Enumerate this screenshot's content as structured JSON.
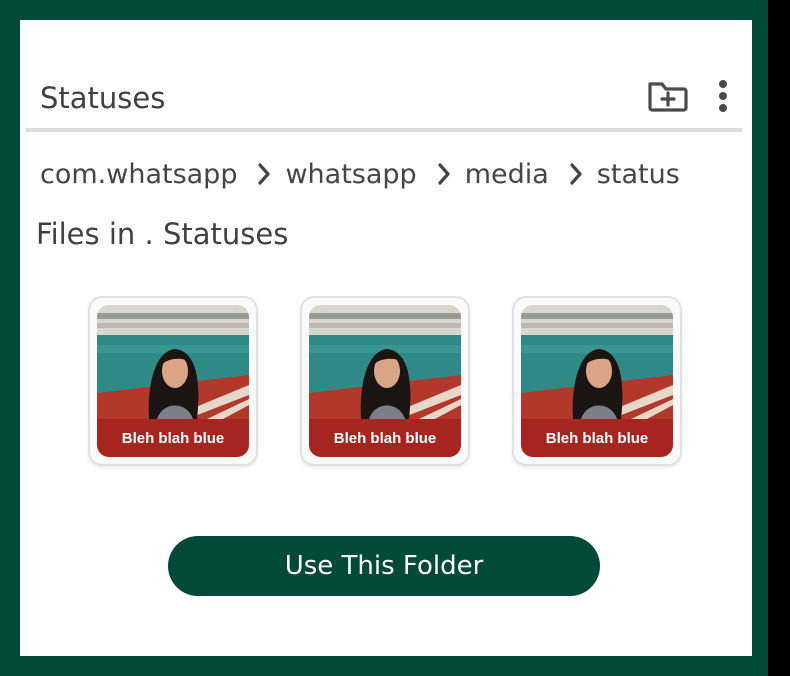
{
  "header": {
    "title": "Statuses",
    "new_folder_icon": "create-new-folder-icon",
    "more_icon": "more-vertical-icon"
  },
  "breadcrumb": {
    "items": [
      "com.whatsapp",
      "whatsapp",
      "media",
      "status"
    ],
    "separator_icon": "chevron-right-icon"
  },
  "files": {
    "label": "Files in . Statuses",
    "items": [
      {
        "caption": "Bleh blah blue"
      },
      {
        "caption": "Bleh blah blue"
      },
      {
        "caption": "Bleh blah blue"
      }
    ]
  },
  "action": {
    "use_folder_label": "Use This Folder"
  },
  "colors": {
    "accent": "#024a38",
    "caption_bg": "#a62520",
    "text": "#404040"
  }
}
